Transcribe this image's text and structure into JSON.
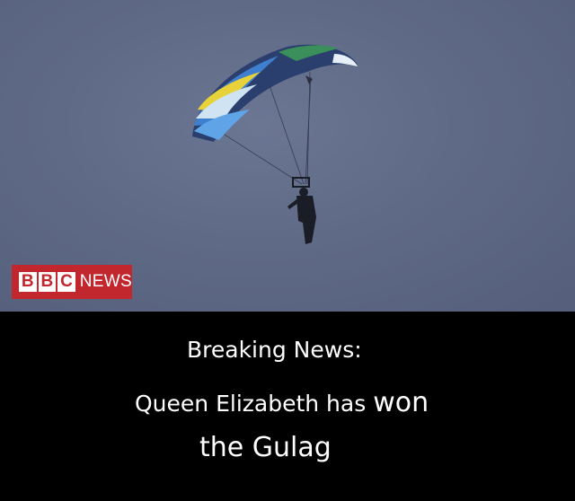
{
  "logo": {
    "letters": [
      "B",
      "B",
      "C"
    ],
    "suffix": "NEWS"
  },
  "caption": {
    "line1": "Breaking News:",
    "line2_start": "Queen Elizabeth has ",
    "line2_big": "won",
    "line3": "the Gulag"
  },
  "colors": {
    "sky": "#5f6a86",
    "logo_red": "#c2272d",
    "caption_bg": "#000000",
    "caption_text": "#ffffff",
    "canopy_navy": "#2b3f6e",
    "canopy_blue": "#3f7fd0",
    "canopy_yellow": "#e8d23a",
    "canopy_light": "#cfe3f2"
  },
  "scene": {
    "subject": "parachutist-under-canopy"
  }
}
